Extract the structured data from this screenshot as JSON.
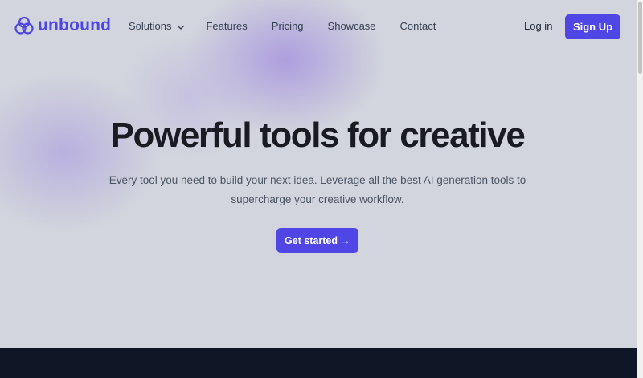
{
  "brand": {
    "name": "unbound",
    "logo_icon": "unbound-logo-icon",
    "color": "#4f46e5"
  },
  "nav": {
    "items": [
      {
        "label": "Solutions",
        "icon": "chevron-down-icon"
      },
      {
        "label": "Features"
      },
      {
        "label": "Pricing"
      },
      {
        "label": "Showcase"
      },
      {
        "label": "Contact"
      }
    ]
  },
  "auth": {
    "login_label": "Log in",
    "signup_label": "Sign Up"
  },
  "hero": {
    "title": "Powerful tools for creative",
    "subtitle": "Every tool you need to build your next idea. Leverage all the best AI generation tools to supercharge your creative workflow.",
    "cta_label": "Get started →"
  },
  "colors": {
    "accent": "#4f46e5",
    "background": "#d2d5dd",
    "dark_band": "#0f1626"
  }
}
